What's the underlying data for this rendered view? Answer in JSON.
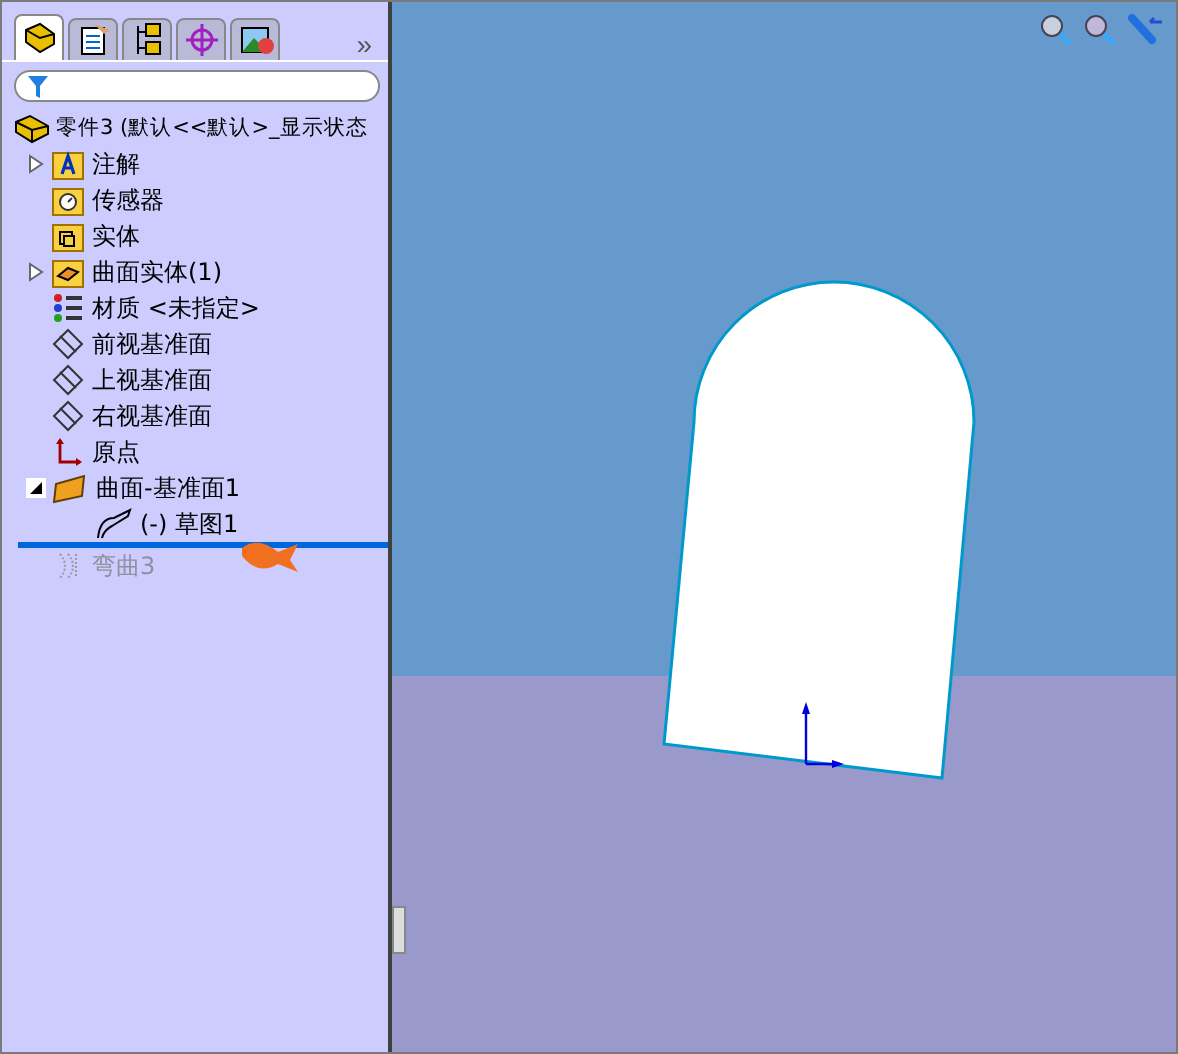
{
  "panel": {
    "tabs": [
      {
        "kind": "features",
        "selected": true
      },
      {
        "kind": "properties",
        "selected": false
      },
      {
        "kind": "config",
        "selected": false
      },
      {
        "kind": "dimxpert",
        "selected": false
      },
      {
        "kind": "display",
        "selected": false
      }
    ],
    "more": "»",
    "tree": {
      "label": "零件3 (默认<<默认>_显示状态",
      "kind": "part",
      "children": [
        {
          "label": "注解",
          "kind": "annotation",
          "expanded": false,
          "rolled_back": false
        },
        {
          "label": "传感器",
          "kind": "sensor",
          "rolled_back": false
        },
        {
          "label": "实体",
          "kind": "solid",
          "rolled_back": false
        },
        {
          "label": "曲面实体(1)",
          "kind": "surface",
          "expanded": false,
          "rolled_back": false
        },
        {
          "label": "材质 <未指定>",
          "kind": "material",
          "rolled_back": false
        },
        {
          "label": "前视基准面",
          "kind": "plane",
          "rolled_back": false
        },
        {
          "label": "上视基准面",
          "kind": "plane",
          "rolled_back": false
        },
        {
          "label": "右视基准面",
          "kind": "plane",
          "rolled_back": false
        },
        {
          "label": "原点",
          "kind": "origin",
          "rolled_back": false
        },
        {
          "label": "曲面-基准面1",
          "kind": "planar",
          "expanded": true,
          "rolled_back": false,
          "children": [
            {
              "label": "(-) 草图1",
              "kind": "sketch",
              "rolled_back": false
            }
          ]
        },
        {
          "label": "弯曲3",
          "kind": "flex",
          "rolled_back": true
        }
      ]
    }
  }
}
